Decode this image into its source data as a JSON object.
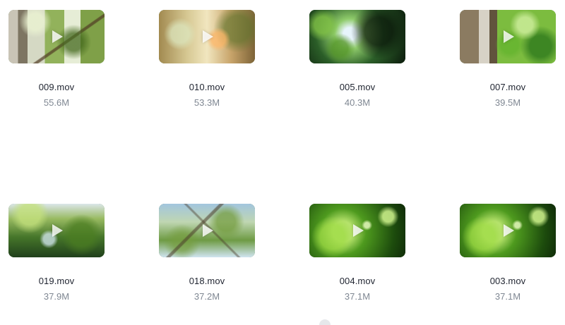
{
  "files": [
    {
      "name": "009.mov",
      "size": "55.6M"
    },
    {
      "name": "010.mov",
      "size": "53.3M"
    },
    {
      "name": "005.mov",
      "size": "40.3M"
    },
    {
      "name": "007.mov",
      "size": "39.5M"
    },
    {
      "name": "019.mov",
      "size": "37.9M"
    },
    {
      "name": "018.mov",
      "size": "37.2M"
    },
    {
      "name": "004.mov",
      "size": "37.1M"
    },
    {
      "name": "003.mov",
      "size": "37.1M"
    }
  ],
  "icons": {
    "play": "play-icon"
  }
}
